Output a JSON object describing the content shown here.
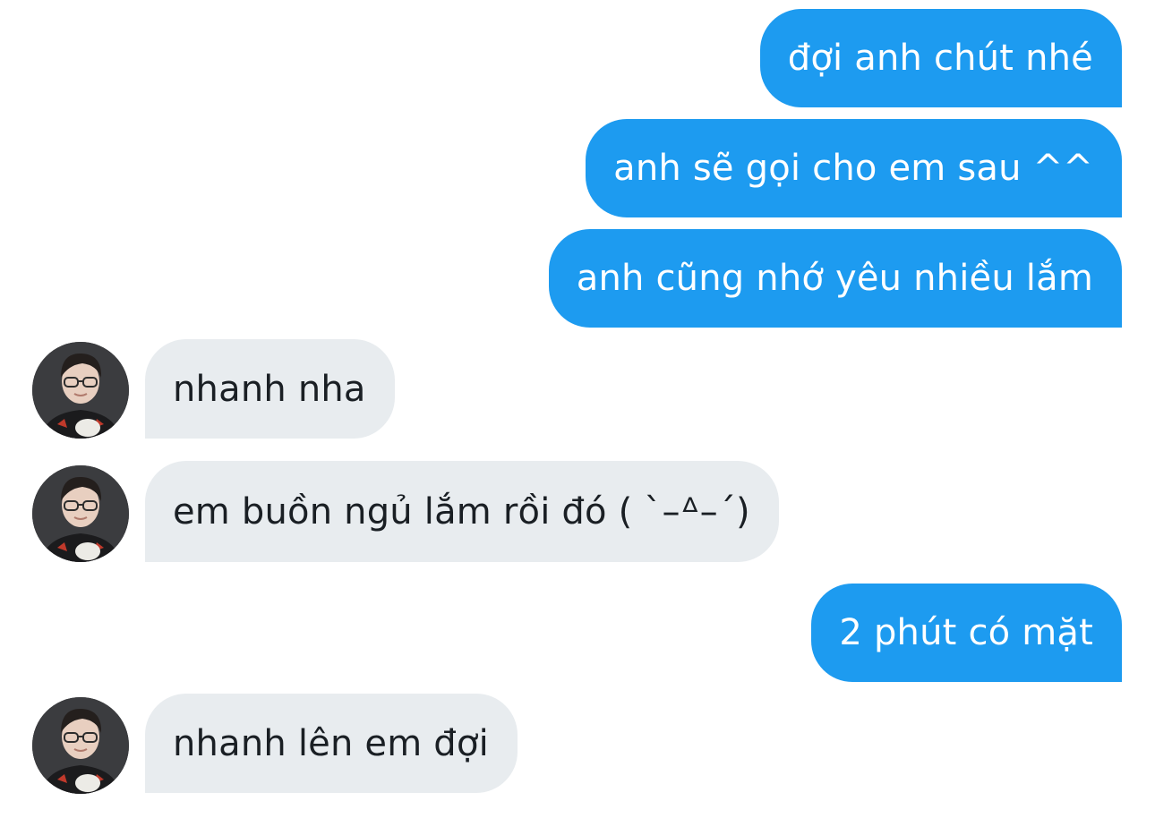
{
  "conversation": {
    "messages": [
      {
        "direction": "sent",
        "text": "đợi anh chút nhé"
      },
      {
        "direction": "sent",
        "text": "anh sẽ gọi cho em sau ^^"
      },
      {
        "direction": "sent",
        "text": "anh cũng nhớ yêu nhiều lắm"
      },
      {
        "direction": "received",
        "text": "nhanh nha",
        "avatar_icon": "profile-photo"
      },
      {
        "direction": "received",
        "text": "em buồn ngủ lắm rồi đó ( `–ᐞ–´)",
        "avatar_icon": "profile-photo"
      },
      {
        "direction": "sent",
        "text": "2 phút có mặt"
      },
      {
        "direction": "received",
        "text": "nhanh lên em đợi",
        "avatar_icon": "profile-photo"
      }
    ]
  },
  "colors": {
    "sent_bubble": "#1d9bf0",
    "sent_text": "#ffffff",
    "received_bubble": "#e8ecef",
    "received_text": "#1a1f24"
  }
}
